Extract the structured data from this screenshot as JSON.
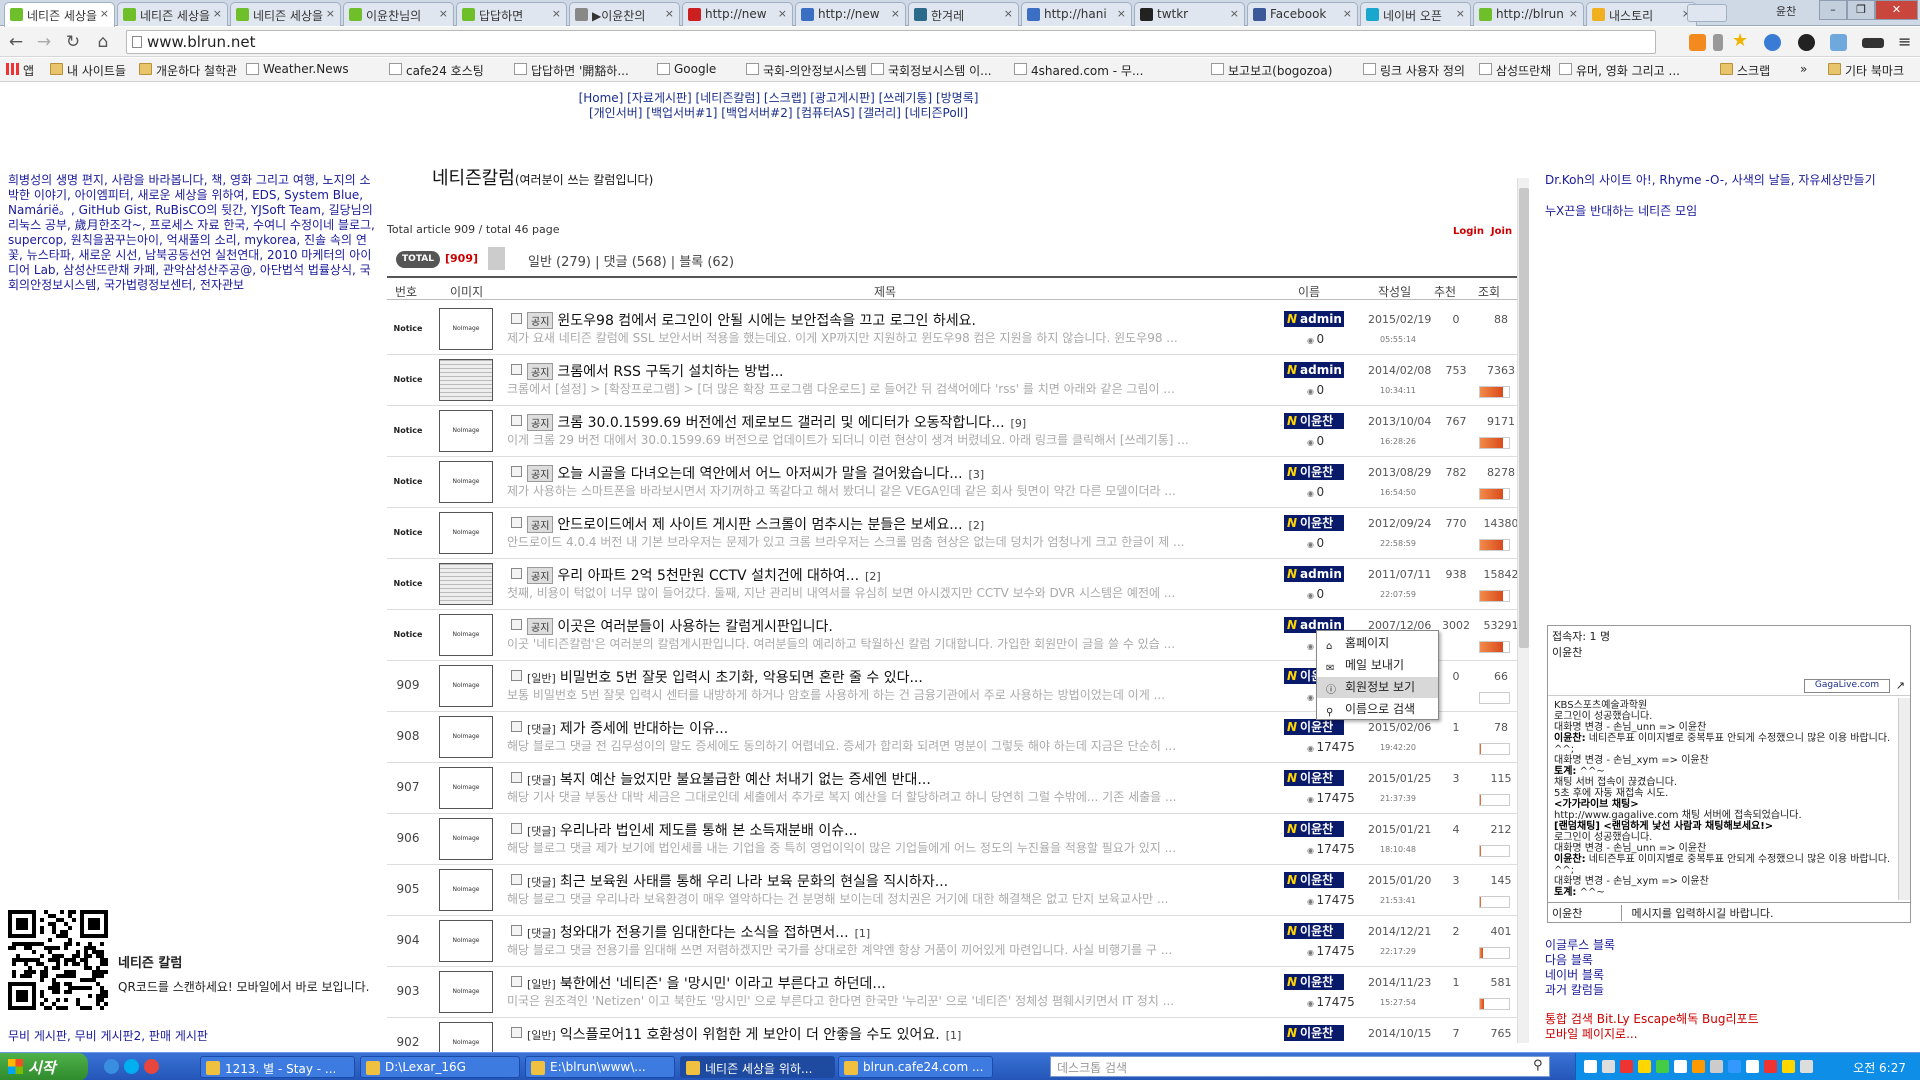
{
  "browser": {
    "tabs": [
      {
        "title": "네티즌 세상을",
        "color": "#6fbf2a"
      },
      {
        "title": "네티즌 세상을",
        "color": "#6fbf2a"
      },
      {
        "title": "네티즌 세상을",
        "color": "#6fbf2a"
      },
      {
        "title": "이윤찬님의",
        "color": "#6fbf2a"
      },
      {
        "title": "답답하면",
        "color": "#6fbf2a"
      },
      {
        "title": "▶이윤찬의",
        "color": "#888888"
      },
      {
        "title": "http://new",
        "color": "#cc2020"
      },
      {
        "title": "http://new",
        "color": "#3a6fc4"
      },
      {
        "title": "한겨레",
        "color": "#2a6a8a"
      },
      {
        "title": "http://hani",
        "color": "#3a6fc4"
      },
      {
        "title": "twtkr",
        "color": "#222222"
      },
      {
        "title": "Facebook",
        "color": "#3b5998"
      },
      {
        "title": "네이버 오픈",
        "color": "#19a7ce"
      },
      {
        "title": "http://blrun",
        "color": "#6fbf2a"
      },
      {
        "title": "내스토리",
        "color": "#f0b020"
      }
    ],
    "profile_label": "윤찬",
    "url": "www.blrun.net",
    "bookmarks": [
      {
        "label": "앱",
        "icon": "apps-icon"
      },
      {
        "label": "내 사이트들",
        "icon": "folder"
      },
      {
        "label": "개운하다 철학관",
        "icon": "folder"
      },
      {
        "label": "Weather.News",
        "icon": "page"
      },
      {
        "label": "cafe24 호스팅",
        "icon": "page"
      },
      {
        "label": "답답하면 '開豁하...",
        "icon": "page"
      },
      {
        "label": "Google",
        "icon": "page"
      },
      {
        "label": "국회-의안정보시스템",
        "icon": "page"
      },
      {
        "label": "국회정보시스템 이...",
        "icon": "page"
      },
      {
        "label": "4shared.com - 무...",
        "icon": "page"
      },
      {
        "label": "보고보고(bogozoa)",
        "icon": "page"
      },
      {
        "label": "링크 사용자 정의",
        "icon": "page"
      },
      {
        "label": "삼성뜨란채",
        "icon": "page"
      },
      {
        "label": "유머, 영화 그리고 ...",
        "icon": "page"
      },
      {
        "label": "스크랩",
        "icon": "folder"
      },
      {
        "label": "»",
        "icon": "none"
      },
      {
        "label": "기타 북마크",
        "icon": "folder"
      }
    ]
  },
  "site": {
    "topnav_line1": "[Home] [자료게시판] [네티즌칼럼] [스크랩] [광고게시판] [쓰레기통] [방명록]",
    "topnav_line2": "[개인서버] [백업서버#1] [백업서버#2] [컴퓨터AS] [갤러리] [네티즌Poll]",
    "left_links": "희병성의 생명 편지, 사람을 바라봅니다, 책, 영화 그리고 여행, 노지의 소박한 이야기, 아이엠피터, 새로운 세상을 위하여, EDS, System Blue, Namárië。, GitHub Gist, RuBisCO의 뒷간, YJSoft Team, 길당님의 리눅스 공부, 歲月한조각~, 프로세스 자료 한국, 수여니 수정이네 블로그, supercop, 원칙을꿈꾸는아이, 억새풀의 소리, mykorea, 진솔 속의 연꽃, 뉴스타파, 새로운 시선, 남북공동선언 실천연대, 2010 마케터의 아이디어 Lab, 삼성산뜨란채 카페, 관악삼성산주공@, 아단법석 법률상식, 국회의안정보시스템, 국가법령정보센터, 전자관보",
    "qr_title": "네티즌 칼럼",
    "qr_desc": "QR코드를 스캔하세요! 모바일에서 바로 보입니다.",
    "left_footer": "무비 게시판, 무비 게시판2, 판매 게시판",
    "right_links_1": "Dr.Koh의 사이트 아!, Rhyme -O-, 사색의 날들, 자유세상만들기",
    "right_links_2": "누X끈을 반대하는 네티즌 모임",
    "right_blog": [
      "이글루스 블록",
      "다음 블록",
      "네이버 블록",
      "과거 칼럼들"
    ],
    "right_search": [
      "통합 검색 Bit.Ly Escape해독 Bug리포트",
      "모바일 페이지로..."
    ]
  },
  "board": {
    "title": "네티즌칼럼",
    "subtitle": "(여러분이 쓰는 칼럼입니다)",
    "stats": "Total article 909 / total 46 page",
    "login": "Login",
    "join": "Join",
    "total_label": "TOTAL",
    "total_count": "[909]",
    "filters": "일반 (279)   |   댓글 (568)   |   블록 (62)",
    "headers": {
      "num": "번호",
      "image": "이미지",
      "title": "제목",
      "name": "이름",
      "date": "작성일",
      "rec": "추천",
      "views": "조회"
    },
    "rows": [
      {
        "num": "Notice",
        "tag": "공지",
        "title": "윈도우98 컴에서 로그인이 안될 시에는 보안접속을 끄고 로그인 하세요.",
        "comments": "",
        "preview": "제가 요새 네티즌 칼럼에 SSL 보안서버 적용을 했는데요. 이게 XP까지만 지원하고 윈도우98 컴은 지원을 하지 않습니다. 윈도우98 ...",
        "author": "admin",
        "points": "0",
        "date": "2015/02/19",
        "time": "05:55:14",
        "rec": "0",
        "views": "88",
        "bar": 0.0,
        "thumb": "noimage"
      },
      {
        "num": "Notice",
        "tag": "공지",
        "title": "크롬에서 RSS 구독기 설치하는 방법...",
        "comments": "",
        "preview": "크롬에서 [설정] > [확장프로그램] > [더 많은 확장 프로그램 다운로드] 로 들어간 뒤 검색어에다 'rss' 를 치면 아래와 같은 그림이 ...",
        "author": "admin",
        "points": "0",
        "date": "2014/02/08",
        "time": "10:34:11",
        "rec": "753",
        "views": "7363",
        "bar": 0.8,
        "thumb": "image"
      },
      {
        "num": "Notice",
        "tag": "공지",
        "title": "크롬 30.0.1599.69 버전에선 제로보드 갤러리 및 에디터가 오동작합니다...",
        "comments": "[9]",
        "preview": "이게 크롬 29 버전 대에서 30.0.1599.69 버전으로 업데이트가 되더니 이런 현상이 생겨 버렸네요. 아래 링크를 클릭해서 [쓰레기통] ...",
        "author": "이윤찬",
        "points": "0",
        "date": "2013/10/04",
        "time": "16:28:26",
        "rec": "767",
        "views": "9171",
        "bar": 0.8,
        "thumb": "noimage"
      },
      {
        "num": "Notice",
        "tag": "공지",
        "title": "오늘 시골을 다녀오는데 역안에서 어느 아저씨가 말을 걸어왔습니다...",
        "comments": "[3]",
        "preview": "제가 사용하는 스마트폰을 바라보시면서 자기꺼하고 똑같다고 해서 봤더니 같은 VEGA인데 같은 회사 뒷면이 약간 다른 모델이더라 ...",
        "author": "이윤찬",
        "points": "0",
        "date": "2013/08/29",
        "time": "16:54:50",
        "rec": "782",
        "views": "8278",
        "bar": 0.8,
        "thumb": "noimage"
      },
      {
        "num": "Notice",
        "tag": "공지",
        "title": "안드로이드에서 제 사이트 게시판 스크롤이 멈추시는 분들은 보세요...",
        "comments": "[2]",
        "preview": "안드로이드 4.0.4 버전 내 기본 브라우저는 문제가 있고 크롬 브라우저는 스크롤 멈춤 현상은 없는데 덩치가 엄청나게 크고 한글이 제 ...",
        "author": "이윤찬",
        "points": "0",
        "date": "2012/09/24",
        "time": "22:58:59",
        "rec": "770",
        "views": "14380",
        "bar": 0.8,
        "thumb": "noimage"
      },
      {
        "num": "Notice",
        "tag": "공지",
        "title": "우리 아파트 2억 5천만원 CCTV 설치건에 대하여...",
        "comments": "[2]",
        "preview": "첫째, 비용이 턱없이 너무 많이 들어갔다. 둘째, 지난 관리비 내역서를 유심히 보면 아시겠지만 CCTV 보수와 DVR 시스템은 예전에 ...",
        "author": "admin",
        "points": "0",
        "date": "2011/07/11",
        "time": "22:07:59",
        "rec": "938",
        "views": "15842",
        "bar": 0.8,
        "thumb": "image"
      },
      {
        "num": "Notice",
        "tag": "공지",
        "title": "이곳은 여러분들이 사용하는 칼럼게시판입니다.",
        "comments": "",
        "preview": "이곳 '네티즌칼럼'은 여러분의 칼럼게시판입니다. 여러분들의 예리하고 탁월하신 칼럼 기대합니다. 가입한 회원만이 글을 쓸 수 있습 ...",
        "author": "admin",
        "points": "0",
        "date": "2007/12/06",
        "time": "",
        "rec": "3002",
        "views": "53291",
        "bar": 0.8,
        "thumb": "noimage"
      },
      {
        "num": "909",
        "tag": "[일반]",
        "title": "비밀번호 5번 잘못 입력시 초기화, 악용되면 혼란 줄 수 있다...",
        "comments": "",
        "preview": "보통 비밀번호 5번 잘못 입력시 센터를 내방하게 하거나 암호를 사용하게 하는 건 금융기관에서 주로 사용하는 방법이었는데 이게 ...",
        "author": "이윤찬",
        "points": "17475",
        "date": "",
        "time": "",
        "rec": "0",
        "views": "66",
        "bar": 0.0,
        "thumb": "noimage"
      },
      {
        "num": "908",
        "tag": "[댓글]",
        "title": "제가 증세에 반대하는 이유...",
        "comments": "",
        "preview": "해당 블로그 댓글 전 김무성이의 말도 증세에도 동의하기 어렵네요. 증세가 합리화 되려면 명분이 그렇듯 해야 하는데 지금은 단순히 ...",
        "author": "이윤찬",
        "points": "17475",
        "date": "2015/02/06",
        "time": "19:42:20",
        "rec": "1",
        "views": "78",
        "bar": 0.05,
        "thumb": "noimage"
      },
      {
        "num": "907",
        "tag": "[댓글]",
        "title": "복지 예산 늘었지만 불요불급한 예산 처내기 없는 증세엔 반대...",
        "comments": "",
        "preview": "해당 기사 댓글 부동산 대박 세금은 그대로인데 세출에서 추가로 복지 예산을 더 할당하려고 하니 당연히 그럴 수밖에... 기존 세출을 ...",
        "author": "이윤찬",
        "points": "17475",
        "date": "2015/01/25",
        "time": "21:37:39",
        "rec": "3",
        "views": "115",
        "bar": 0.05,
        "thumb": "noimage"
      },
      {
        "num": "906",
        "tag": "[댓글]",
        "title": "우리나라 법인세 제도를 통해 본 소득재분배 이슈...",
        "comments": "",
        "preview": "해당 블로그 댓글 제가 보기에 법인세를 내는 기업을 중 특히 영업이익이 많은 기업들에게 어느 정도의 누진율을 적용할 필요가 있지 ...",
        "author": "이윤찬",
        "points": "17475",
        "date": "2015/01/21",
        "time": "18:10:48",
        "rec": "4",
        "views": "212",
        "bar": 0.05,
        "thumb": "noimage"
      },
      {
        "num": "905",
        "tag": "[댓글]",
        "title": "최근 보육원 사태를 통해 우리 나라 보육 문화의 현실을 직시하자...",
        "comments": "",
        "preview": "해당 블로그 댓글 우리나라 보육환경이 매우 열악하다는 건 분명해 보이는데 정치권은 거기에 대한 해결책은 없고 단지 보육교사만 ...",
        "author": "이윤찬",
        "points": "17475",
        "date": "2015/01/20",
        "time": "21:53:41",
        "rec": "3",
        "views": "145",
        "bar": 0.05,
        "thumb": "noimage"
      },
      {
        "num": "904",
        "tag": "[댓글]",
        "title": "청와대가 전용기를 임대한다는 소식을 접하면서...",
        "comments": "[1]",
        "preview": "해당 블로그 댓글 전용기를 임대해 쓰면 저렴하겠지만 국가를 상대로한 계약엔 항상 거품이 끼어있게 마련입니다. 사실 비행기를 구 ...",
        "author": "이윤찬",
        "points": "17475",
        "date": "2014/12/21",
        "time": "22:17:29",
        "rec": "2",
        "views": "401",
        "bar": 0.1,
        "thumb": "noimage"
      },
      {
        "num": "903",
        "tag": "[일반]",
        "title": "북한에선 '네티즌' 을 '망시민' 이라고 부른다고 하던데...",
        "comments": "",
        "preview": "미국은 원조격인 'Netizen' 이고 북한도 '망시민' 으로 부른다고 한다면 한국만 '누리꾼' 으로 '네티즌' 정체성 폄훼시키면서 IT 정치 ...",
        "author": "이윤찬",
        "points": "17475",
        "date": "2014/11/23",
        "time": "15:27:54",
        "rec": "1",
        "views": "581",
        "bar": 0.15,
        "thumb": "noimage"
      },
      {
        "num": "902",
        "tag": "[일반]",
        "title": "익스플로어11 호환성이 위험한 게 보안이 더 안좋을 수도 있어요.",
        "comments": "[1]",
        "preview": "",
        "author": "이윤찬",
        "points": "",
        "date": "2014/10/15",
        "time": "",
        "rec": "7",
        "views": "765",
        "bar": 0.0,
        "thumb": "noimage"
      }
    ]
  },
  "context_menu": {
    "items": [
      {
        "label": "홈페이지",
        "icon": "home-icon"
      },
      {
        "label": "메일 보내기",
        "icon": "mail-icon"
      },
      {
        "label": "회원정보 보기",
        "icon": "info-icon"
      },
      {
        "label": "이름으로 검색",
        "icon": "search-icon"
      }
    ]
  },
  "chat": {
    "users_label": "접속자: 1 명",
    "user": "이윤찬",
    "gagalive": "GagaLive.com",
    "log": [
      {
        "b": "",
        "t": "KBS스포츠예술과학원"
      },
      {
        "b": "",
        "t": "로그인이 성공했습니다."
      },
      {
        "b": "",
        "t": "대화명 변경 - 손님_unn => 이윤찬"
      },
      {
        "b": "이윤찬:",
        "t": " 네티즌투표 이미지별로 중복투표 안되게 수정했으니 많은 이용 바랍니다. ^^;"
      },
      {
        "b": "",
        "t": "대화명 변경 - 손님_xym => 이윤찬"
      },
      {
        "b": "토계:",
        "t": " ^^~"
      },
      {
        "b": "",
        "t": "채팅 서버 접속이 끊겼습니다."
      },
      {
        "b": "",
        "t": "5초 후에 자동 재접속 시도."
      },
      {
        "b": "<가가라이브 채팅>",
        "t": ""
      },
      {
        "b": "",
        "t": "http://www.gagalive.com 채팅 서버에 접속되었습니다."
      },
      {
        "b": "[랜덤채팅] <랜덤하게 낯선 사람과 채팅해보세요!>",
        "t": ""
      },
      {
        "b": "",
        "t": "로그인이 성공했습니다."
      },
      {
        "b": "",
        "t": "대화명 변경 - 손님_unn => 이윤찬"
      },
      {
        "b": "이윤찬:",
        "t": " 네티즌투표 이미지별로 중복투표 안되게 수정했으니 많은 이용 바랍니다. ^^;"
      },
      {
        "b": "",
        "t": "대화명 변경 - 손님_xym => 이윤찬"
      },
      {
        "b": "토계:",
        "t": " ^^~"
      }
    ],
    "input_name": "이윤찬",
    "input_placeholder": "메시지를 입력하시길 바랍니다."
  },
  "taskbar": {
    "start": "시작",
    "items": [
      "1213. 별 - Stay - ...",
      "D:\\Lexar_16G",
      "E:\\blrun\\www\\...",
      "네티즌 세상을 위하...",
      "blrun.cafe24.com ..."
    ],
    "search_placeholder": "데스크톱 검색",
    "clock": "오전 6:27"
  }
}
